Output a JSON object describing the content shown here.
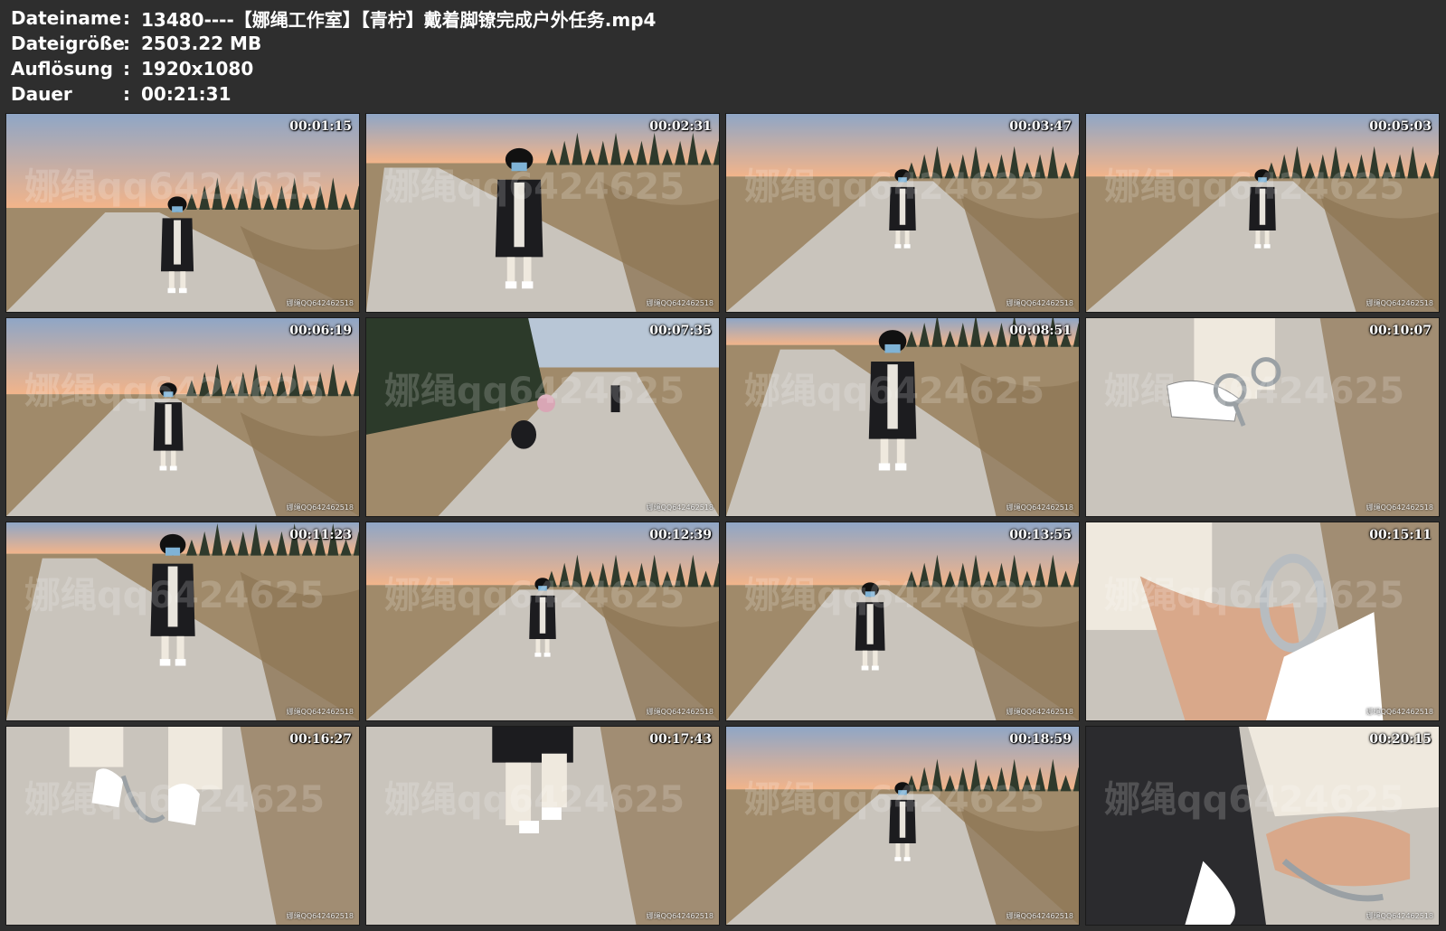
{
  "file_info": {
    "rows": [
      {
        "label": "Dateiname",
        "value": "13480----【娜绳工作室】【青柠】戴着脚镣完成户外任务.mp4"
      },
      {
        "label": "Dateigröße",
        "value": "2503.22 MB"
      },
      {
        "label": "Auflösung",
        "value": "1920x1080"
      },
      {
        "label": "Dauer",
        "value": "00:21:31"
      }
    ],
    "separator": ":"
  },
  "watermark": {
    "big": "娜绳qq6424625",
    "small": "娜绳QQ642462518"
  },
  "frames": [
    {
      "timestamp": "00:01:15",
      "scene": "sunset-path-back"
    },
    {
      "timestamp": "00:02:31",
      "scene": "walking-close"
    },
    {
      "timestamp": "00:03:47",
      "scene": "standing-center"
    },
    {
      "timestamp": "00:05:03",
      "scene": "standing-center"
    },
    {
      "timestamp": "00:06:19",
      "scene": "standing-left"
    },
    {
      "timestamp": "00:07:35",
      "scene": "crouching-trees"
    },
    {
      "timestamp": "00:08:51",
      "scene": "standing-large"
    },
    {
      "timestamp": "00:10:07",
      "scene": "feet-closeup"
    },
    {
      "timestamp": "00:11:23",
      "scene": "standing-large-left"
    },
    {
      "timestamp": "00:12:39",
      "scene": "standing-center"
    },
    {
      "timestamp": "00:13:55",
      "scene": "standing-trees"
    },
    {
      "timestamp": "00:15:11",
      "scene": "shackle-closeup"
    },
    {
      "timestamp": "00:16:27",
      "scene": "chain-feet"
    },
    {
      "timestamp": "00:17:43",
      "scene": "legs-walking"
    },
    {
      "timestamp": "00:18:59",
      "scene": "standing-center"
    },
    {
      "timestamp": "00:20:15",
      "scene": "hands-chain-closeup"
    }
  ],
  "colors": {
    "background": "#2e2e2e",
    "sky_top": "#8fa6c6",
    "sky_bottom": "#f2b48a",
    "road": "#c9c4bc",
    "grass": "#a08a6a",
    "coat": "#1c1c1f"
  }
}
